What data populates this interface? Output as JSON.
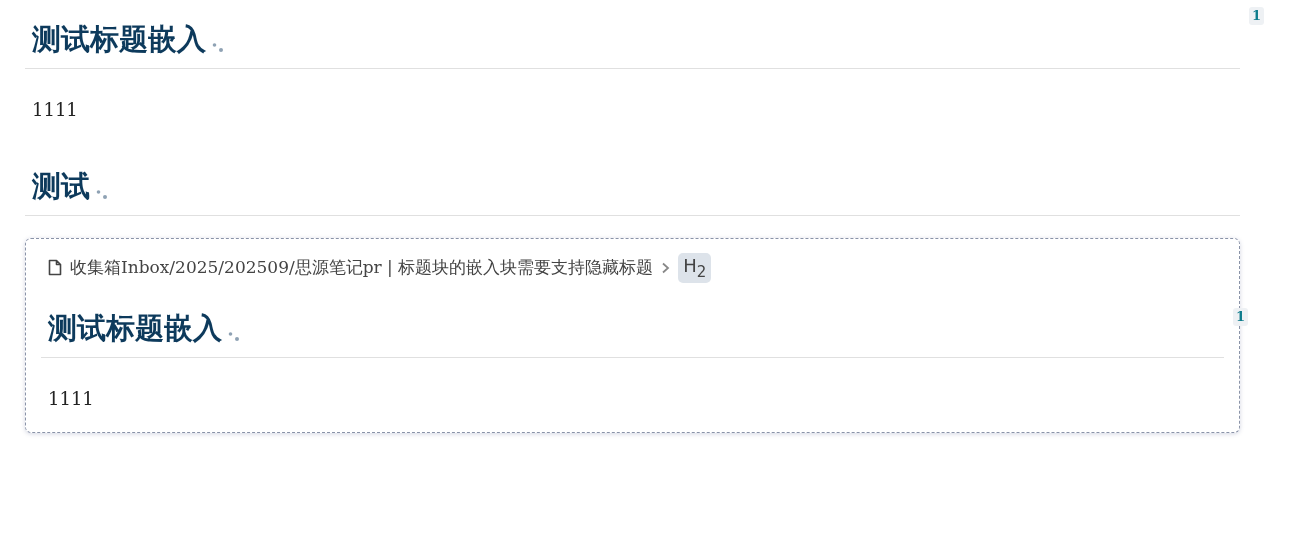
{
  "blocks": [
    {
      "kind": "heading",
      "text": "测试标题嵌入",
      "ref_count": "1"
    },
    {
      "kind": "paragraph",
      "text": "1111"
    },
    {
      "kind": "heading",
      "text": "测试"
    },
    {
      "kind": "embed",
      "ref_count": "1",
      "breadcrumb": {
        "path": "收集箱Inbox/2025/202509/思源笔记pr | 标题块的嵌入块需要支持隐藏标题",
        "heading_tag": "H$_{2}$"
      },
      "blocks": [
        {
          "kind": "heading",
          "text": "测试标题嵌入"
        },
        {
          "kind": "paragraph",
          "text": "1111"
        }
      ]
    }
  ]
}
